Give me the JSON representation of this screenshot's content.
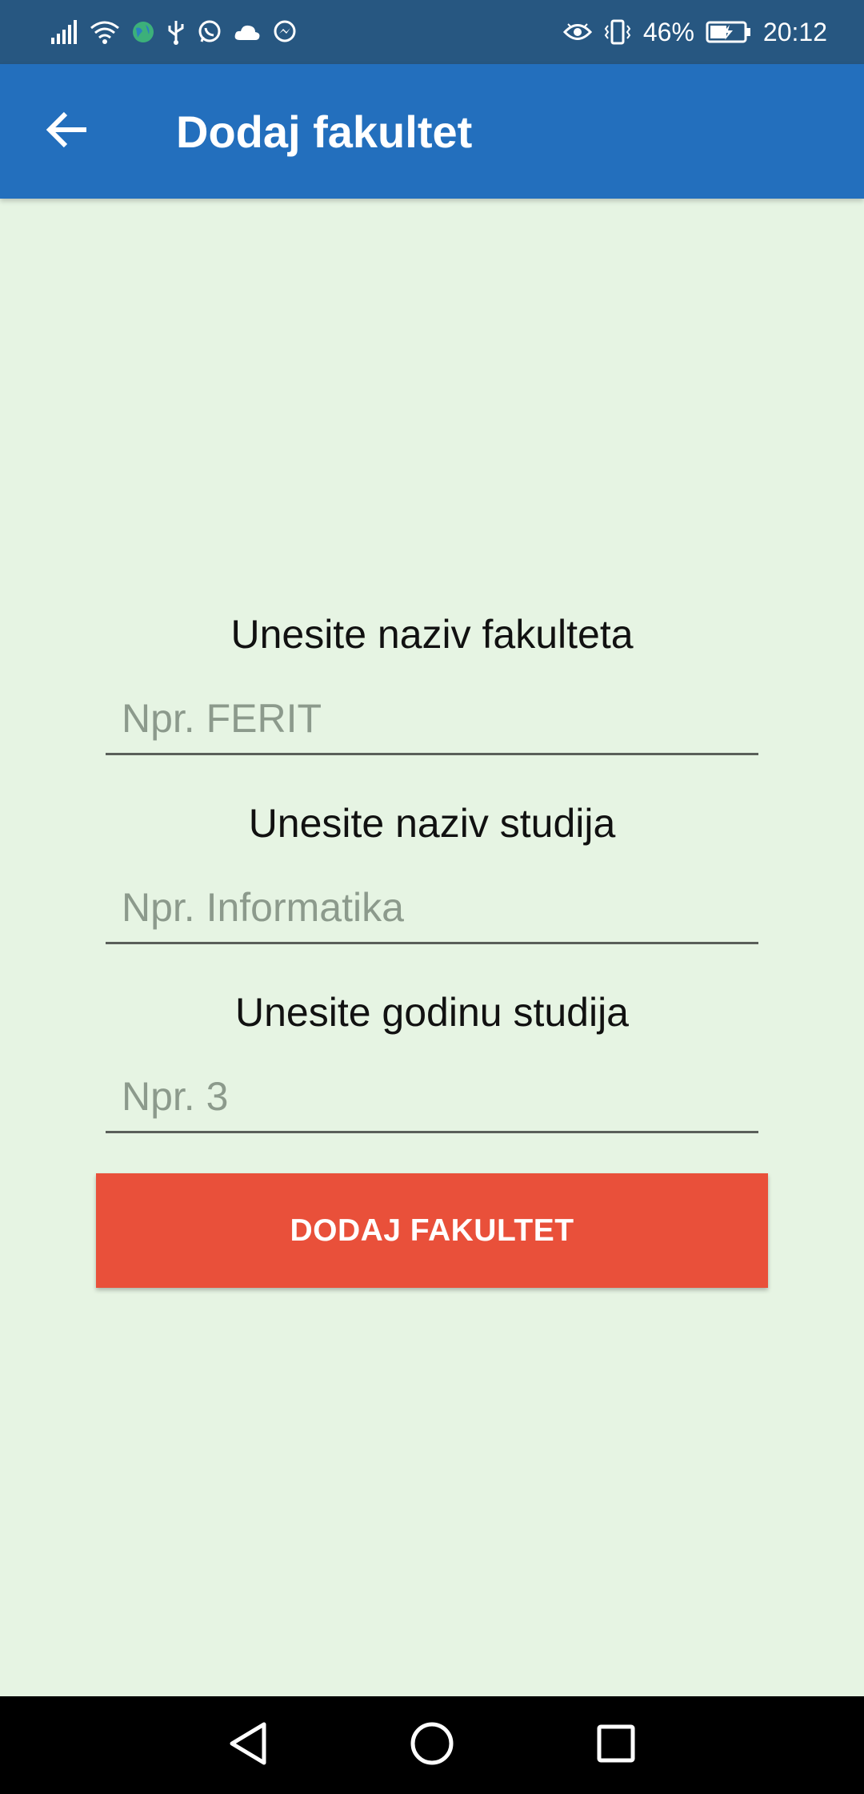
{
  "status_bar": {
    "battery_percent": "46%",
    "time": "20:12",
    "left_icons": [
      "signal-icon",
      "wifi-icon",
      "vpn-globe-icon",
      "usb-icon",
      "whatsapp-icon",
      "cloud-icon",
      "messenger-icon"
    ],
    "right_icons": [
      "eye-comfort-icon",
      "vibrate-icon",
      "battery-charging-icon"
    ]
  },
  "app_bar": {
    "title": "Dodaj fakultet",
    "back_icon": "arrow-back-icon",
    "color": "#236fbd"
  },
  "form": {
    "faculty_label": "Unesite naziv fakulteta",
    "faculty_placeholder": "Npr. FERIT",
    "faculty_value": "",
    "study_label": "Unesite naziv studija",
    "study_placeholder": "Npr. Informatika",
    "study_value": "",
    "year_label": "Unesite godinu studija",
    "year_placeholder": "Npr. 3",
    "year_value": "",
    "submit_label": "DODAJ FAKULTET",
    "submit_color": "#e9503a"
  },
  "nav_bar": {
    "icons": [
      "back-triangle-icon",
      "home-circle-icon",
      "recents-square-icon"
    ]
  },
  "colors": {
    "background": "#e6f4e3",
    "status_bar": "#275781"
  }
}
